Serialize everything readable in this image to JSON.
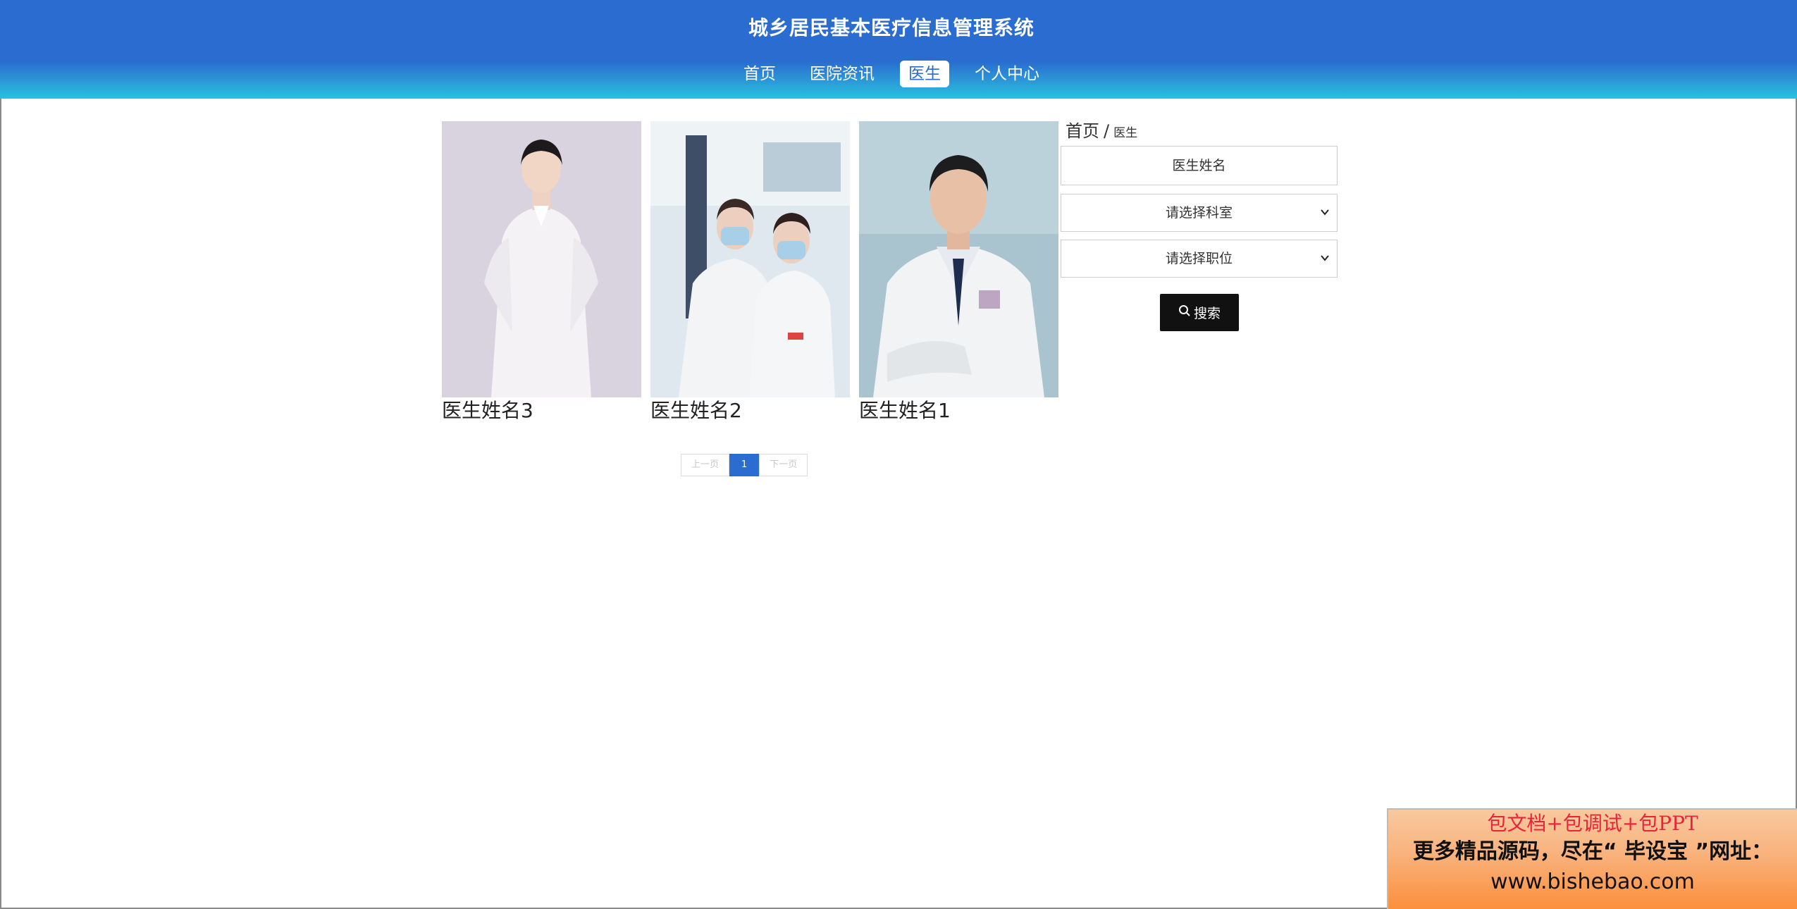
{
  "header": {
    "title": "城乡居民基本医疗信息管理系统",
    "nav": [
      {
        "label": "首页",
        "active": false
      },
      {
        "label": "医院资讯",
        "active": false
      },
      {
        "label": "医生",
        "active": true
      },
      {
        "label": "个人中心",
        "active": false
      }
    ]
  },
  "doctors": [
    {
      "name": "医生姓名3"
    },
    {
      "name": "医生姓名2"
    },
    {
      "name": "医生姓名1"
    }
  ],
  "breadcrumb": {
    "home": "首页",
    "separator": "/",
    "current": "医生"
  },
  "filters": {
    "name_placeholder": "医生姓名",
    "department_placeholder": "请选择科室",
    "position_placeholder": "请选择职位",
    "search_label": "搜索"
  },
  "pagination": {
    "prev": "上一页",
    "current": "1",
    "next": "下一页"
  },
  "ad": {
    "line1": "包文档+包调试+包PPT",
    "line2": "更多精品源码，尽在“ 毕设宝 ”网址：",
    "line3": "www.bishebao.com"
  },
  "colors": {
    "primary": "#2a6ccf",
    "header_bottom": "#27c2de",
    "search_button": "#111111"
  }
}
